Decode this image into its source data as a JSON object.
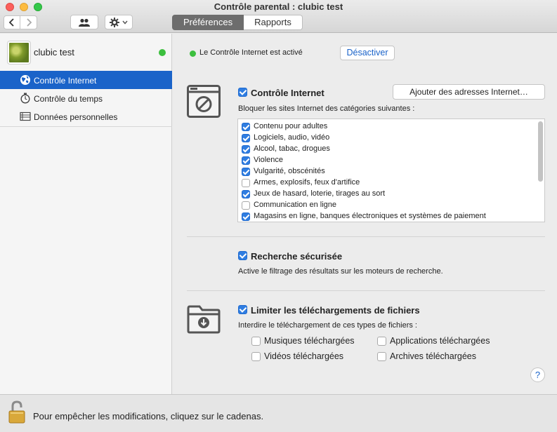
{
  "window": {
    "title": "Contrôle parental : clubic test"
  },
  "toolbar": {
    "back_icon": "chevron-left-icon",
    "forward_icon": "chevron-right-icon",
    "users_icon": "users-icon",
    "gear_icon": "gear-icon",
    "tabs": [
      {
        "label": "Préférences",
        "active": true
      },
      {
        "label": "Rapports",
        "active": false
      }
    ]
  },
  "sidebar": {
    "user": {
      "name": "clubic test",
      "online": true
    },
    "items": [
      {
        "label": "Contrôle Internet",
        "icon": "globe-icon",
        "selected": true
      },
      {
        "label": "Contrôle du temps",
        "icon": "stopwatch-icon",
        "selected": false
      },
      {
        "label": "Données personnelles",
        "icon": "contacts-icon",
        "selected": false
      }
    ]
  },
  "status": {
    "text": "Le Contrôle Internet est activé",
    "deactivate_label": "Désactiver"
  },
  "internet": {
    "title": "Contrôle Internet",
    "enabled": true,
    "add_button": "Ajouter des adresses Internet…",
    "description": "Bloquer les sites Internet des catégories suivantes :",
    "categories": [
      {
        "label": "Contenu pour adultes",
        "checked": true
      },
      {
        "label": "Logiciels, audio, vidéo",
        "checked": true
      },
      {
        "label": "Alcool, tabac, drogues",
        "checked": true
      },
      {
        "label": "Violence",
        "checked": true
      },
      {
        "label": "Vulgarité, obscénités",
        "checked": true
      },
      {
        "label": "Armes, explosifs, feux d'artifice",
        "checked": false
      },
      {
        "label": "Jeux de hasard, loterie, tirages au sort",
        "checked": true
      },
      {
        "label": "Communication en ligne",
        "checked": false
      },
      {
        "label": "Magasins en ligne, banques électroniques et systèmes de paiement",
        "checked": true
      }
    ]
  },
  "safe_search": {
    "title": "Recherche sécurisée",
    "enabled": true,
    "description": "Active le filtrage des résultats sur les moteurs de recherche."
  },
  "downloads": {
    "title": "Limiter les téléchargements de fichiers",
    "enabled": true,
    "description": "Interdire le téléchargement de ces types de fichiers :",
    "types": [
      {
        "label": "Musiques téléchargées",
        "checked": false
      },
      {
        "label": "Applications téléchargées",
        "checked": false
      },
      {
        "label": "Vidéos téléchargées",
        "checked": false
      },
      {
        "label": "Archives téléchargées",
        "checked": false
      }
    ]
  },
  "help_label": "?",
  "footer": {
    "text": "Pour empêcher les modifications, cliquez sur le cadenas."
  },
  "colors": {
    "accent": "#1a63c9",
    "checkbox": "#2f7de1",
    "status_green": "#3cbf3e"
  }
}
